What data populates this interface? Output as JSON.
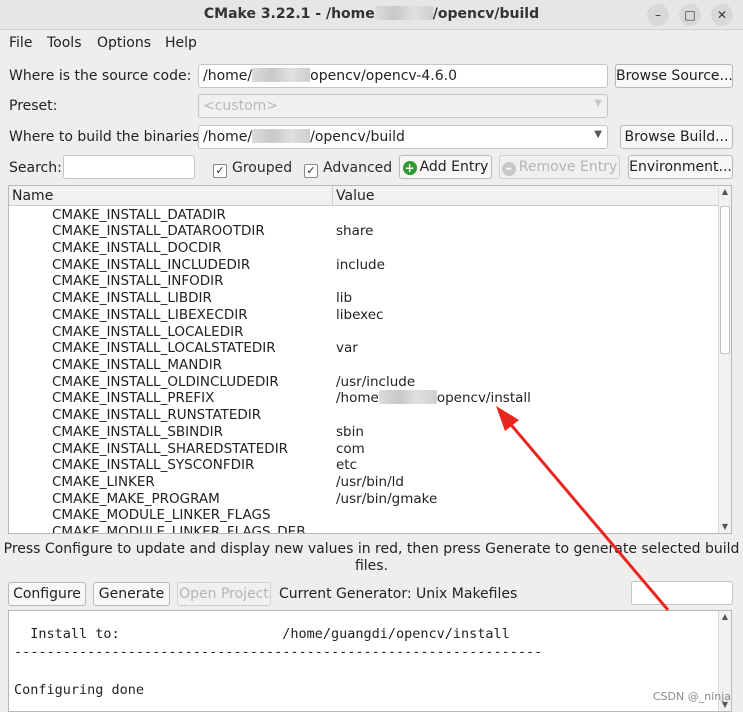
{
  "window": {
    "title_prefix": "CMake 3.22.1 - /home",
    "title_suffix": "/opencv/build",
    "minimize_glyph": "–",
    "maximize_glyph": "□",
    "close_glyph": "✕"
  },
  "menu": [
    {
      "label": "File"
    },
    {
      "label": "Tools"
    },
    {
      "label": "Options"
    },
    {
      "label": "Help"
    }
  ],
  "source": {
    "label": "Where is the source code:",
    "value_prefix": "/home/",
    "value_suffix": "opencv/opencv-4.6.0",
    "browse_label": "Browse Source..."
  },
  "preset": {
    "label": "Preset:",
    "value": "<custom>"
  },
  "build": {
    "label": "Where to build the binaries:",
    "value_prefix": "/home/",
    "value_suffix": "/opencv/build",
    "browse_label": "Browse Build..."
  },
  "search": {
    "label": "Search:",
    "value": ""
  },
  "options": {
    "grouped_label": "Grouped",
    "advanced_label": "Advanced",
    "check_glyph": "✓",
    "add_entry_label": "Add Entry",
    "remove_entry_label": "Remove Entry",
    "environment_label": "Environment...",
    "plus_glyph": "+",
    "minus_glyph": "–"
  },
  "table": {
    "name_header": "Name",
    "value_header": "Value",
    "rows": [
      {
        "name": "CMAKE_INSTALL_DATADIR",
        "value": ""
      },
      {
        "name": "CMAKE_INSTALL_DATAROOTDIR",
        "value": "share"
      },
      {
        "name": "CMAKE_INSTALL_DOCDIR",
        "value": ""
      },
      {
        "name": "CMAKE_INSTALL_INCLUDEDIR",
        "value": "include"
      },
      {
        "name": "CMAKE_INSTALL_INFODIR",
        "value": ""
      },
      {
        "name": "CMAKE_INSTALL_LIBDIR",
        "value": "lib"
      },
      {
        "name": "CMAKE_INSTALL_LIBEXECDIR",
        "value": "libexec"
      },
      {
        "name": "CMAKE_INSTALL_LOCALEDIR",
        "value": ""
      },
      {
        "name": "CMAKE_INSTALL_LOCALSTATEDIR",
        "value": "var"
      },
      {
        "name": "CMAKE_INSTALL_MANDIR",
        "value": ""
      },
      {
        "name": "CMAKE_INSTALL_OLDINCLUDEDIR",
        "value": "/usr/include"
      },
      {
        "name": "CMAKE_INSTALL_PREFIX",
        "value": "/home",
        "value_suffix": "opencv/install"
      },
      {
        "name": "CMAKE_INSTALL_RUNSTATEDIR",
        "value": ""
      },
      {
        "name": "CMAKE_INSTALL_SBINDIR",
        "value": "sbin"
      },
      {
        "name": "CMAKE_INSTALL_SHAREDSTATEDIR",
        "value": "com"
      },
      {
        "name": "CMAKE_INSTALL_SYSCONFDIR",
        "value": "etc"
      },
      {
        "name": "CMAKE_LINKER",
        "value": "/usr/bin/ld"
      },
      {
        "name": "CMAKE_MAKE_PROGRAM",
        "value": "/usr/bin/gmake"
      },
      {
        "name": "CMAKE_MODULE_LINKER_FLAGS",
        "value": ""
      },
      {
        "name": "CMAKE_MODULE_LINKER_FLAGS_DEB",
        "value": ""
      }
    ]
  },
  "hint": {
    "line1": "Press Configure to update and display new values in red, then press Generate to generate selected build",
    "line2": "files."
  },
  "actions": {
    "configure_label": "Configure",
    "generate_label": "Generate",
    "open_project_label": "Open Project",
    "generator_text": "Current Generator: Unix Makefiles"
  },
  "log": {
    "lines": [
      "  Install to:                    /home/guangdi/opencv/install",
      "-----------------------------------------------------------------",
      "",
      "Configuring done"
    ]
  },
  "watermark": "CSDN @_ninja",
  "colors": {
    "annotation_arrow": "#e8251f",
    "add_icon": "#2f9a2f"
  }
}
